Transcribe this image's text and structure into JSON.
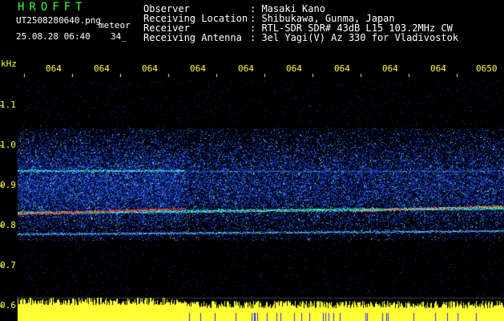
{
  "header": {
    "app_title": "HROFFT",
    "filename": "UT2508280640.png",
    "mode": "meteor",
    "date_time": "25.08.28 06:40",
    "counter": "34_",
    "fields": [
      {
        "label": "Observer",
        "value": ": Masaki Kano"
      },
      {
        "label": "Receiving Location",
        "value": ": Shibukawa, Gunma, Japan"
      },
      {
        "label": "Receiver",
        "value": ": RTL-SDR SDR# 43dB L15 103.2MHz CW"
      },
      {
        "label": "Receiving Antenna",
        "value": ": 3el Yagi(V) Az 330 for Vladivostok"
      }
    ]
  },
  "axes": {
    "y_unit": "kHz",
    "y_ticks": [
      "1.1",
      "1.0",
      "0.9",
      "0.8",
      "0.7",
      "0.6"
    ],
    "x_ticks": [
      "064",
      "064",
      "064",
      "064",
      "064",
      "064",
      "064",
      "064",
      "064",
      "0650"
    ]
  },
  "colors": {
    "text": "#ffffff",
    "accent": "#ffff33",
    "title": "#33ff33",
    "background": "#000000"
  }
}
